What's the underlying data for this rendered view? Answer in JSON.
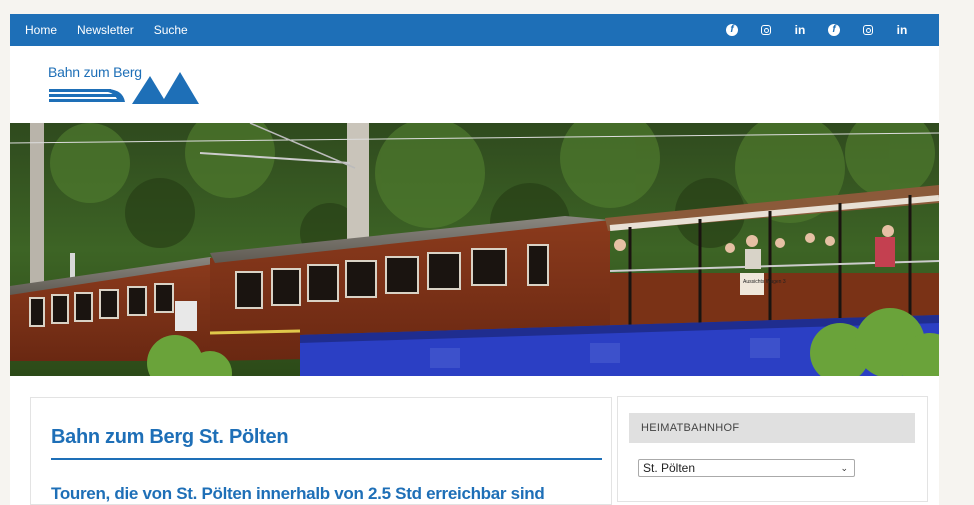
{
  "nav": {
    "home": "Home",
    "newsletter": "Newsletter",
    "search": "Suche"
  },
  "social": [
    {
      "icon": "facebook-icon"
    },
    {
      "icon": "instagram-icon"
    },
    {
      "icon": "linkedin-icon",
      "label": "in"
    },
    {
      "icon": "facebook-icon"
    },
    {
      "icon": "instagram-icon"
    },
    {
      "icon": "linkedin-icon",
      "label": "in"
    }
  ],
  "logo": {
    "text": "Bahn zum Berg"
  },
  "hero": {
    "wagon_sign": "Aussichts Wagen 3"
  },
  "main": {
    "title": "Bahn zum Berg St. Pölten",
    "subtitle": "Touren, die von St. Pölten innerhalb von 2.5 Std erreichbar sind"
  },
  "sidebar": {
    "widget_title": "HEIMATBAHNHOF",
    "select_value": "St. Pölten"
  },
  "colors": {
    "brand": "#1e6fb7",
    "widget_bg": "#e0e0e0"
  }
}
